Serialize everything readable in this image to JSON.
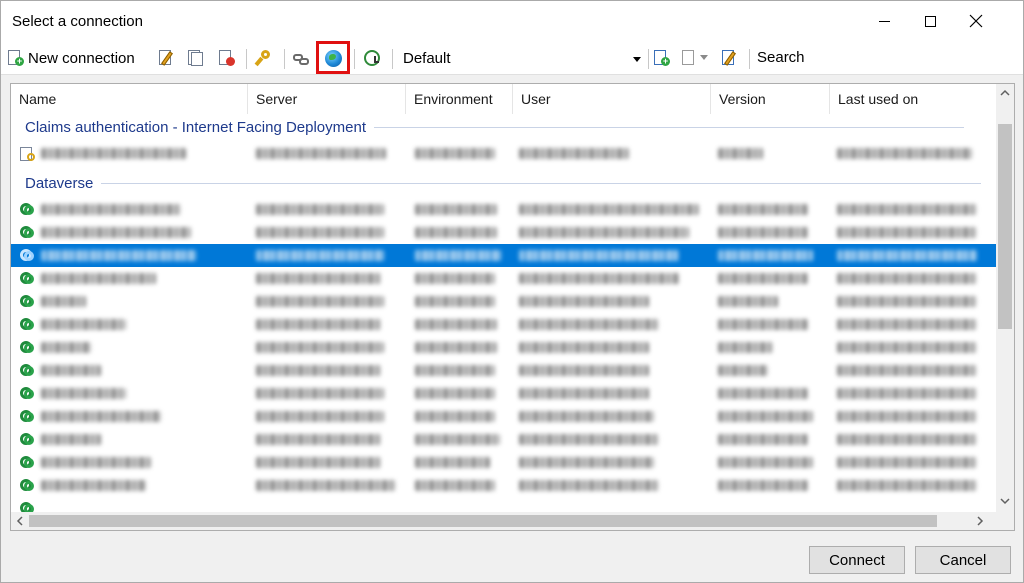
{
  "window": {
    "title": "Select a connection"
  },
  "toolbar": {
    "new_connection_label": "New connection",
    "profile_value": "Default",
    "search_label": "Search",
    "search_value": "",
    "highlight_color": "#e01010"
  },
  "list": {
    "columns": [
      "Name",
      "Server",
      "Environment",
      "User",
      "Version",
      "Last used on"
    ],
    "groups": [
      {
        "title": "Claims authentication - Internet Facing Deployment"
      },
      {
        "title": "Dataverse"
      }
    ],
    "selected_color": "#0078d7",
    "group_color": "#1e3a8c"
  },
  "buttons": {
    "connect": "Connect",
    "cancel": "Cancel"
  }
}
